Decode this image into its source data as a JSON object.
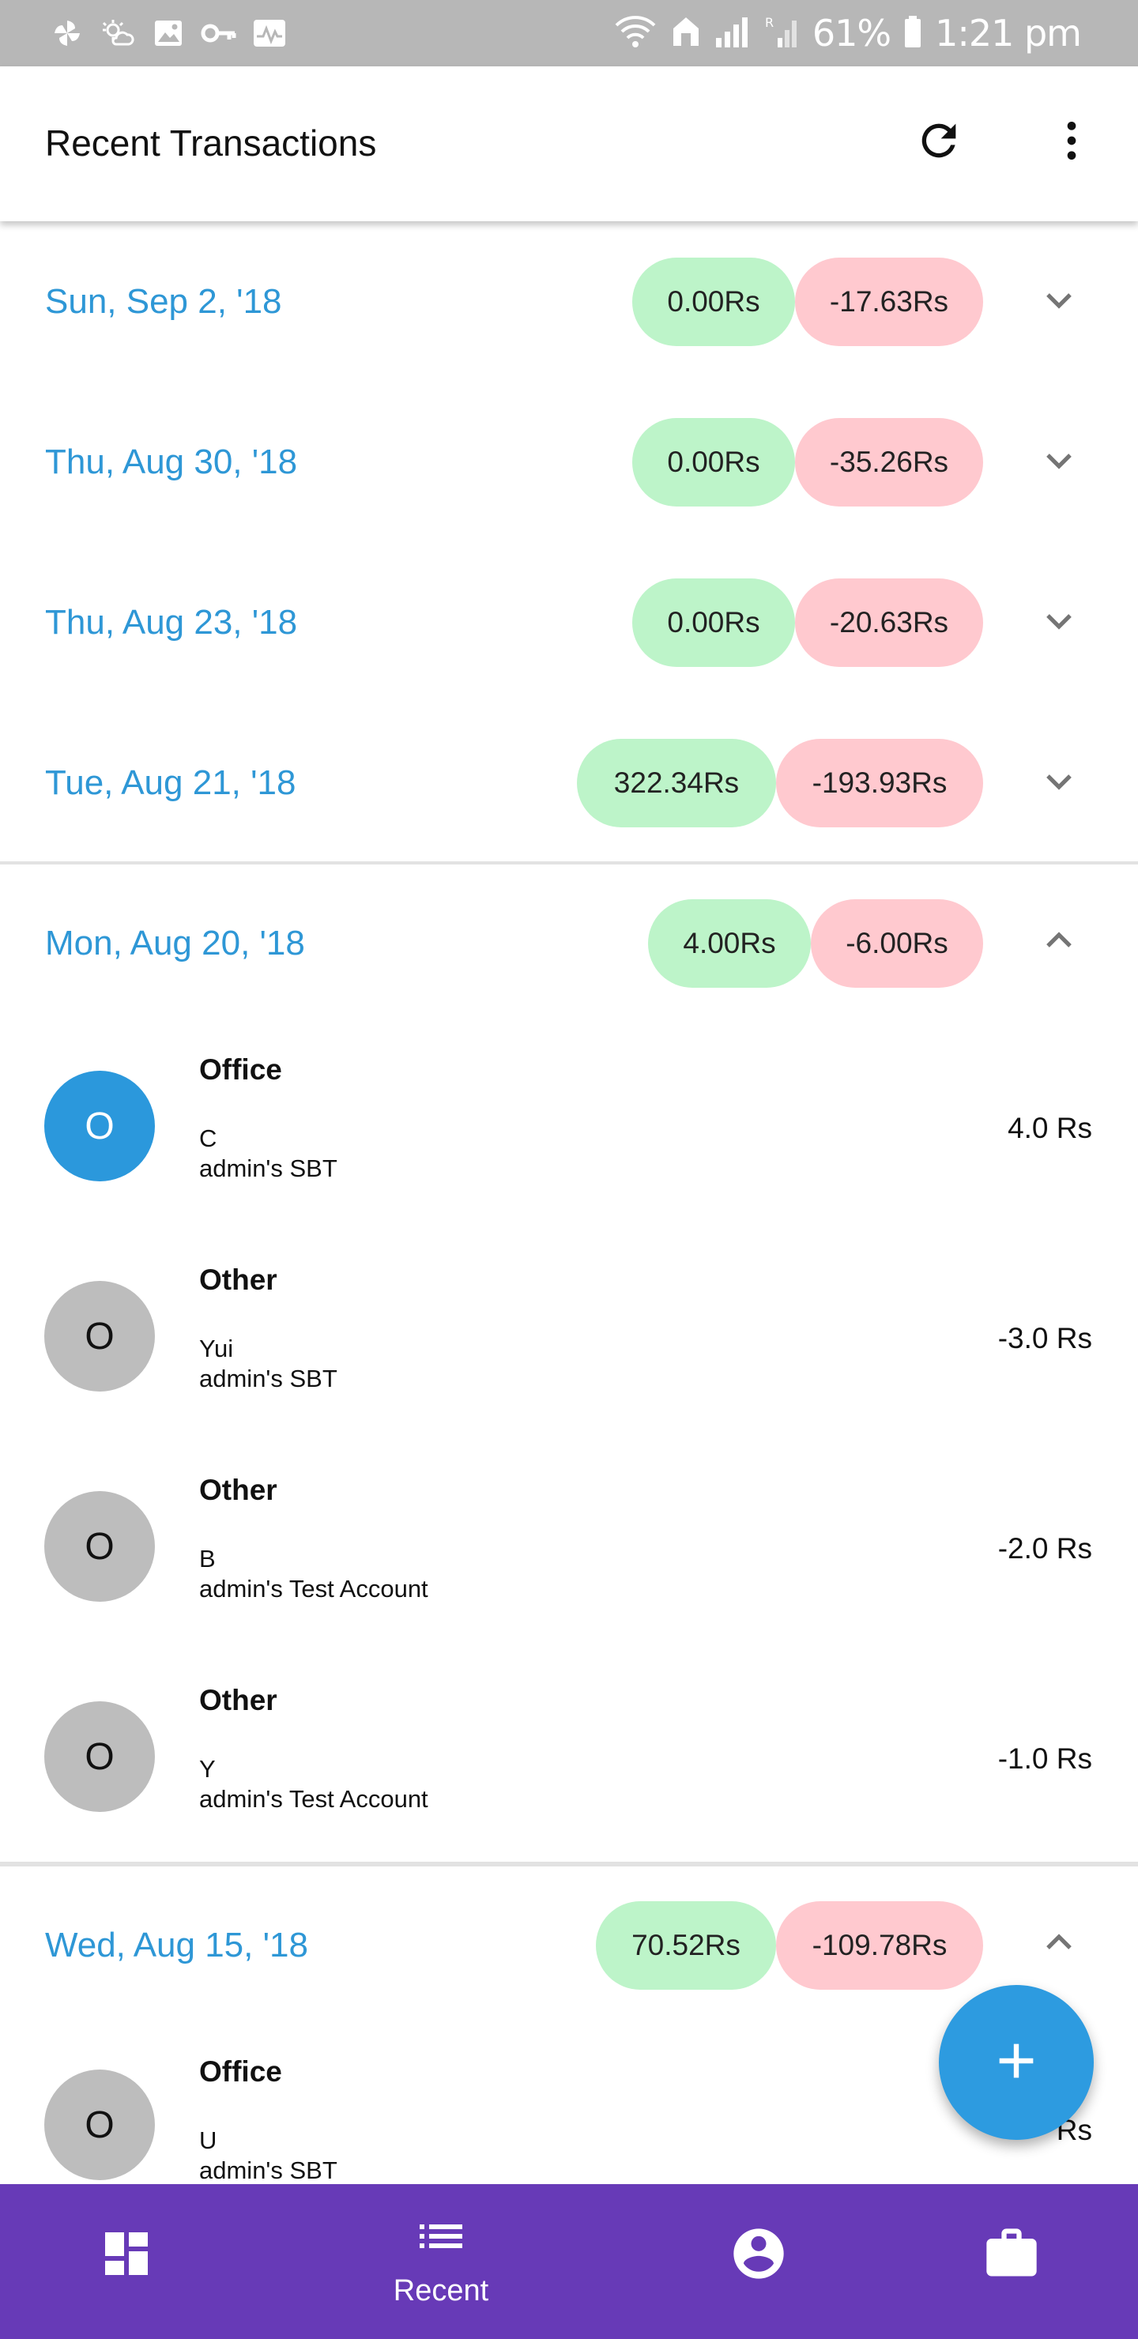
{
  "status_bar": {
    "battery_percent": "61%",
    "time": "1:21 pm",
    "left_icons": [
      "pinwheel-icon",
      "weather-icon",
      "image-icon",
      "key-icon",
      "activity-icon"
    ],
    "right_icons": [
      "wifi-icon",
      "home-icon",
      "signal-icon",
      "signal-roaming-icon",
      "battery-icon"
    ]
  },
  "appbar": {
    "title": "Recent Transactions",
    "refresh_icon": "refresh-icon",
    "more_icon": "more-vert-icon"
  },
  "colors": {
    "accent": "#2e97d6",
    "income_pill": "#bdf4c9",
    "expense_pill": "#ffc9cf",
    "nav_bar": "#673ab7",
    "fab": "#2d9be0",
    "avatar_highlight": "#2b98dc",
    "avatar_default": "#bdbdbd"
  },
  "groups": [
    {
      "date": "Sun, Sep 2, '18",
      "income": "0.00Rs",
      "expense": "-17.63Rs",
      "expanded": false
    },
    {
      "date": "Thu, Aug 30, '18",
      "income": "0.00Rs",
      "expense": "-35.26Rs",
      "expanded": false
    },
    {
      "date": "Thu, Aug 23, '18",
      "income": "0.00Rs",
      "expense": "-20.63Rs",
      "expanded": false
    },
    {
      "date": "Tue, Aug 21, '18",
      "income": "322.34Rs",
      "expense": "-193.93Rs",
      "expanded": false
    },
    {
      "date": "Mon, Aug 20, '18",
      "income": "4.00Rs",
      "expense": "-6.00Rs",
      "expanded": true,
      "transactions": [
        {
          "avatar": "O",
          "category": "Office",
          "payee": "C",
          "account": "admin's SBT",
          "amount": "4.0 Rs"
        },
        {
          "avatar": "O",
          "category": "Other",
          "payee": "Yui",
          "account": "admin's SBT",
          "amount": "-3.0 Rs"
        },
        {
          "avatar": "O",
          "category": "Other",
          "payee": "B",
          "account": "admin's Test Account",
          "amount": "-2.0 Rs"
        },
        {
          "avatar": "O",
          "category": "Other",
          "payee": "Y",
          "account": "admin's Test Account",
          "amount": "-1.0 Rs"
        }
      ]
    },
    {
      "date": "Wed, Aug 15, '18",
      "income": "70.52Rs",
      "expense": "-109.78Rs",
      "expanded": true,
      "transactions": [
        {
          "avatar": "O",
          "category": "Office",
          "payee": "U",
          "account": "admin's SBT",
          "amount": "Rs"
        }
      ]
    }
  ],
  "fab": {
    "icon": "add-icon"
  },
  "bottom_nav": [
    {
      "icon": "dashboard-icon",
      "label": "",
      "active": false
    },
    {
      "icon": "list-icon",
      "label": "Recent",
      "active": true
    },
    {
      "icon": "account-circle-icon",
      "label": "",
      "active": false
    },
    {
      "icon": "briefcase-icon",
      "label": "",
      "active": false
    }
  ]
}
